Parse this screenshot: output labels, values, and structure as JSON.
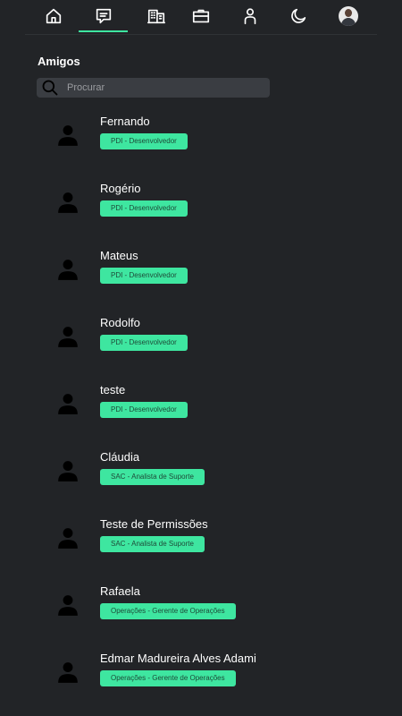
{
  "nav": {
    "items": [
      {
        "name": "home",
        "icon": "home-icon"
      },
      {
        "name": "messages",
        "icon": "chat-icon",
        "active": true
      },
      {
        "name": "company",
        "icon": "building-icon"
      },
      {
        "name": "jobs",
        "icon": "briefcase-icon"
      },
      {
        "name": "profile",
        "icon": "person-icon"
      },
      {
        "name": "theme",
        "icon": "moon-icon"
      },
      {
        "name": "account",
        "icon": "avatar"
      }
    ],
    "accent": "#3ee6a0"
  },
  "section": {
    "title": "Amigos"
  },
  "search": {
    "placeholder": "Procurar"
  },
  "friends": [
    {
      "name": "Fernando",
      "role": "PDI - Desenvolvedor"
    },
    {
      "name": "Rogério",
      "role": "PDI - Desenvolvedor"
    },
    {
      "name": "Mateus",
      "role": "PDI - Desenvolvedor"
    },
    {
      "name": "Rodolfo",
      "role": "PDI - Desenvolvedor"
    },
    {
      "name": "teste",
      "role": "PDI - Desenvolvedor"
    },
    {
      "name": "Cláudia",
      "role": "SAC - Analista de Suporte"
    },
    {
      "name": "Teste de Permissões",
      "role": "SAC - Analista de Suporte"
    },
    {
      "name": "Rafaela",
      "role": "Operações - Gerente de Operações"
    },
    {
      "name": "Edmar Madureira Alves Adami",
      "role": "Operações - Gerente de Operações"
    }
  ],
  "colors": {
    "background": "#222427",
    "badge": "#3ee6a0",
    "badge_text": "#1e4a38"
  }
}
